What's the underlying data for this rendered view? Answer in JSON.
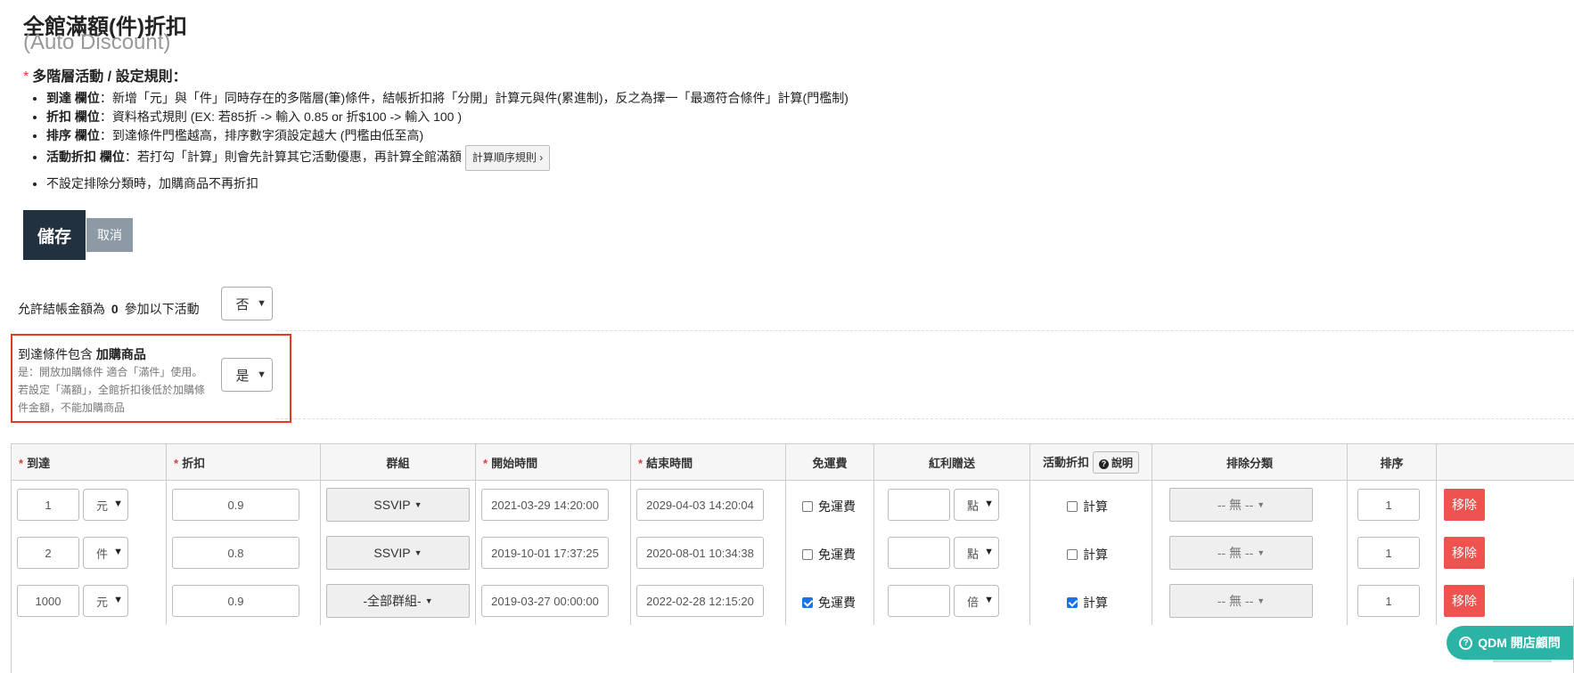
{
  "page": {
    "title": "全館滿額(件)折扣",
    "subtitle": "(Auto Discount)"
  },
  "rules": {
    "required_mark": "*",
    "heading": "多階層活動 / 設定規則：",
    "items": [
      {
        "label": "到達 欄位",
        "text": "：新增「元」與「件」同時存在的多階層(筆)條件，結帳折扣將「分開」計算元與件(累進制)，反之為擇一「最適符合條件」計算(門檻制)"
      },
      {
        "label": "折扣 欄位",
        "text": "：資料格式規則 (EX: 若85折 -> 輸入 0.85 or 折$100 -> 輸入 100 )"
      },
      {
        "label": "排序 欄位",
        "text": "：到達條件門檻越高，排序數字須設定越大 (門檻由低至高)"
      },
      {
        "label": "活動折扣 欄位",
        "text": "：若打勾「計算」則會先計算其它活動優惠，再計算全館滿額"
      }
    ],
    "calc_order_button": "計算順序規則 ›",
    "last_item": "不設定排除分類時，加購商品不再折扣"
  },
  "actions": {
    "save": "儲存",
    "cancel": "取消"
  },
  "options": {
    "allow_zero_prefix": "允許結帳金額為",
    "allow_zero_value": "0",
    "allow_zero_suffix": "參加以下活動",
    "allow_zero_selected": "否",
    "addon_title_prefix": "到達條件包含",
    "addon_title_bold": "加購商品",
    "addon_desc": "是：開放加購條件 適合「滿件」使用。若設定「滿額」，全館折扣後低於加購條件金額，不能加購商品",
    "addon_selected": "是"
  },
  "table": {
    "headers": {
      "reach": "到達",
      "discount": "折扣",
      "group": "群組",
      "start": "開始時間",
      "end": "結束時間",
      "free_shipping": "免運費",
      "bonus": "紅利贈送",
      "activity_discount": "活動折扣",
      "explain": "說明",
      "exclude": "排除分類",
      "sort": "排序"
    },
    "rows": [
      {
        "reach": "1",
        "unit": "元",
        "discount": "0.9",
        "group": "SSVIP",
        "start": "2021-03-29 14:20:00",
        "end": "2029-04-03 14:20:04",
        "free_ship_label": "免運費",
        "free_ship": false,
        "bonus": "",
        "bonus_unit": "點",
        "calc_label": "計算",
        "calc": false,
        "exclude": "-- 無 --",
        "sort": "1",
        "remove": "移除"
      },
      {
        "reach": "2",
        "unit": "件",
        "discount": "0.8",
        "group": "SSVIP",
        "start": "2019-10-01 17:37:25",
        "end": "2020-08-01 10:34:38",
        "free_ship_label": "免運費",
        "free_ship": false,
        "bonus": "",
        "bonus_unit": "點",
        "calc_label": "計算",
        "calc": false,
        "exclude": "-- 無 --",
        "sort": "1",
        "remove": "移除"
      },
      {
        "reach": "1000",
        "unit": "元",
        "discount": "0.9",
        "group": "-全部群組-",
        "start": "2019-03-27 00:00:00",
        "end": "2022-02-28 12:15:20",
        "free_ship_label": "免運費",
        "free_ship": true,
        "bonus": "",
        "bonus_unit": "倍",
        "calc_label": "計算",
        "calc": true,
        "exclude": "-- 無 --",
        "sort": "1",
        "remove": "移除"
      }
    ]
  },
  "help": {
    "label": "QDM 開店顧問"
  },
  "colors": {
    "save_bg": "#22313f",
    "cancel_bg": "#8c9aa6",
    "remove_bg": "#ef5350",
    "highlight_border": "#e53b1f",
    "help_bg": "#2bb3a5",
    "required": "#e53935"
  }
}
